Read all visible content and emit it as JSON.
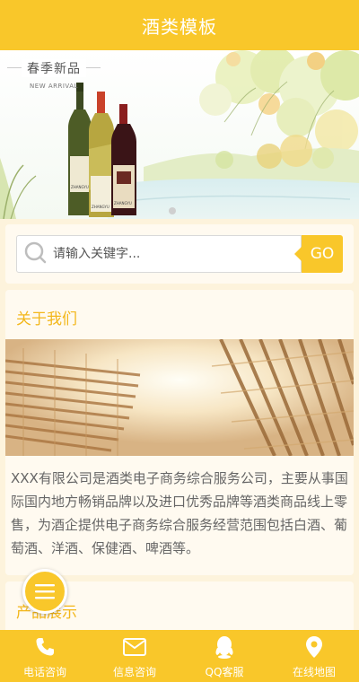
{
  "header": {
    "title": "酒类模板"
  },
  "banner": {
    "caption_cn": "春季新品",
    "caption_en": "NEW ARRIVAL",
    "bottle_labels": [
      "ZHANGYU",
      "ZHANGYU",
      "ZHANGYU"
    ],
    "slide_count": 1
  },
  "search": {
    "placeholder": "请输入关键字...",
    "button_label": "GO"
  },
  "about": {
    "title": "关于我们",
    "body": "XXX有限公司是酒类电子商务综合服务公司，主要从事国际国内地方畅销品牌以及进口优秀品牌等酒类商品线上零售，为酒企提供电子商务综合服务经营范围包括白酒、葡萄酒、洋酒、保健酒、啤酒等。"
  },
  "products": {
    "title": "产品展示"
  },
  "bottom_nav": {
    "items": [
      {
        "label": "电话咨询",
        "icon": "phone-icon"
      },
      {
        "label": "信息咨询",
        "icon": "mail-icon"
      },
      {
        "label": "QQ客服",
        "icon": "qq-icon"
      },
      {
        "label": "在线地图",
        "icon": "map-pin-icon"
      }
    ]
  },
  "colors": {
    "accent": "#f9c72a",
    "section_title": "#f3b71b",
    "page_bg": "#fdf3dc",
    "card_bg": "#fffaf0",
    "body_text": "#666666"
  }
}
